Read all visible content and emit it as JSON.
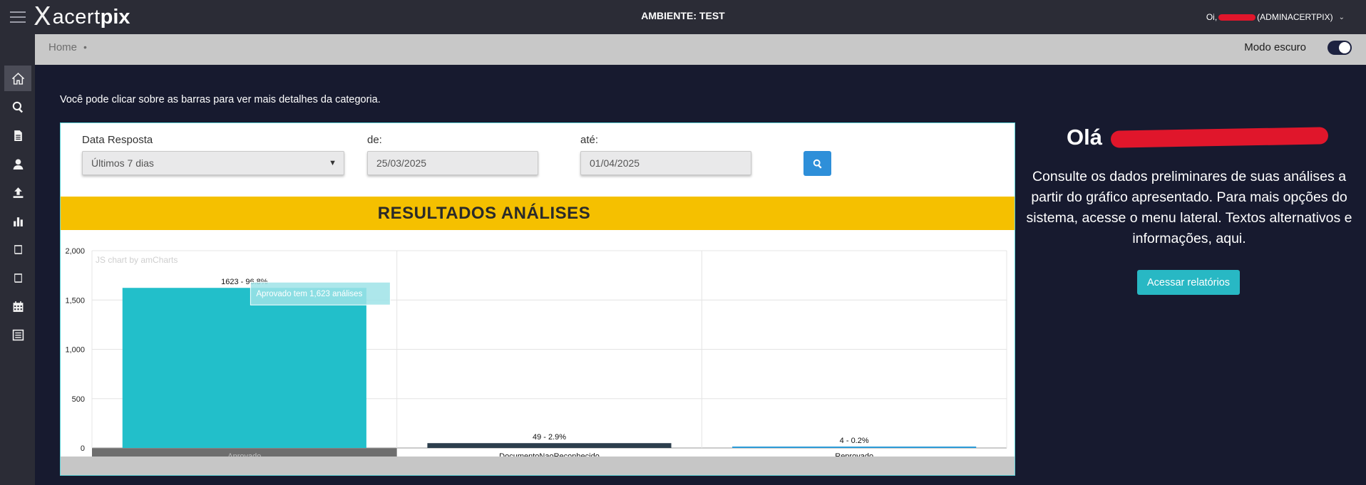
{
  "app": {
    "logo_acert": "acert",
    "logo_pix": "pix",
    "environment": "AMBIENTE: TEST"
  },
  "user": {
    "greeting_prefix": "Oi,",
    "role": "(ADMINACERTPIX)"
  },
  "breadcrumb": {
    "home": "Home",
    "separator": "•"
  },
  "dark_mode": {
    "label": "Modo escuro",
    "enabled": true
  },
  "sidebar": {
    "items": [
      {
        "icon": "home-icon",
        "active": true
      },
      {
        "icon": "search-icon",
        "active": false
      },
      {
        "icon": "document-icon",
        "active": false
      },
      {
        "icon": "user-icon",
        "active": false
      },
      {
        "icon": "upload-icon",
        "active": false
      },
      {
        "icon": "bar-chart-icon",
        "active": false
      },
      {
        "icon": "book-icon",
        "active": false
      },
      {
        "icon": "book-icon",
        "active": false
      },
      {
        "icon": "calendar-icon",
        "active": false
      },
      {
        "icon": "list-icon",
        "active": false
      }
    ]
  },
  "hint": "Você pode clicar sobre as barras para ver mais detalhes da categoria.",
  "filters": {
    "data_resposta_label": "Data Resposta",
    "data_resposta_value": "Últimos 7 dias",
    "de_label": "de:",
    "de_value": "25/03/2025",
    "ate_label": "até:",
    "ate_value": "01/04/2025"
  },
  "banner": "RESULTADOS ANÁLISES",
  "chart_data": {
    "type": "bar",
    "title": "RESULTADOS ANÁLISES",
    "watermark": "JS chart by amCharts",
    "categories": [
      "Aprovado",
      "DocumentoNaoReconhecido",
      "Reprovado"
    ],
    "values": [
      1623,
      49,
      4
    ],
    "value_labels": [
      "1623 - 96.8%",
      "49 - 2.9%",
      "4 - 0.2%"
    ],
    "colors": [
      "#22bfca",
      "#2c3e4c",
      "#2b9bd8"
    ],
    "ylim": [
      0,
      2000
    ],
    "yticks": [
      0,
      500,
      1000,
      1500,
      2000
    ],
    "ytick_labels": [
      "0",
      "500",
      "1,000",
      "1,500",
      "2,000"
    ],
    "tooltip": "Aprovado tem 1,623 análises",
    "selected_category": "Aprovado",
    "grid": true
  },
  "right_panel": {
    "greeting": "Olá",
    "info": "Consulte os dados preliminares de suas análises a partir do gráfico apresentado. Para mais opções do sistema, acesse o menu lateral. Textos alternativos e informações, aqui.",
    "button": "Acessar relatórios"
  }
}
